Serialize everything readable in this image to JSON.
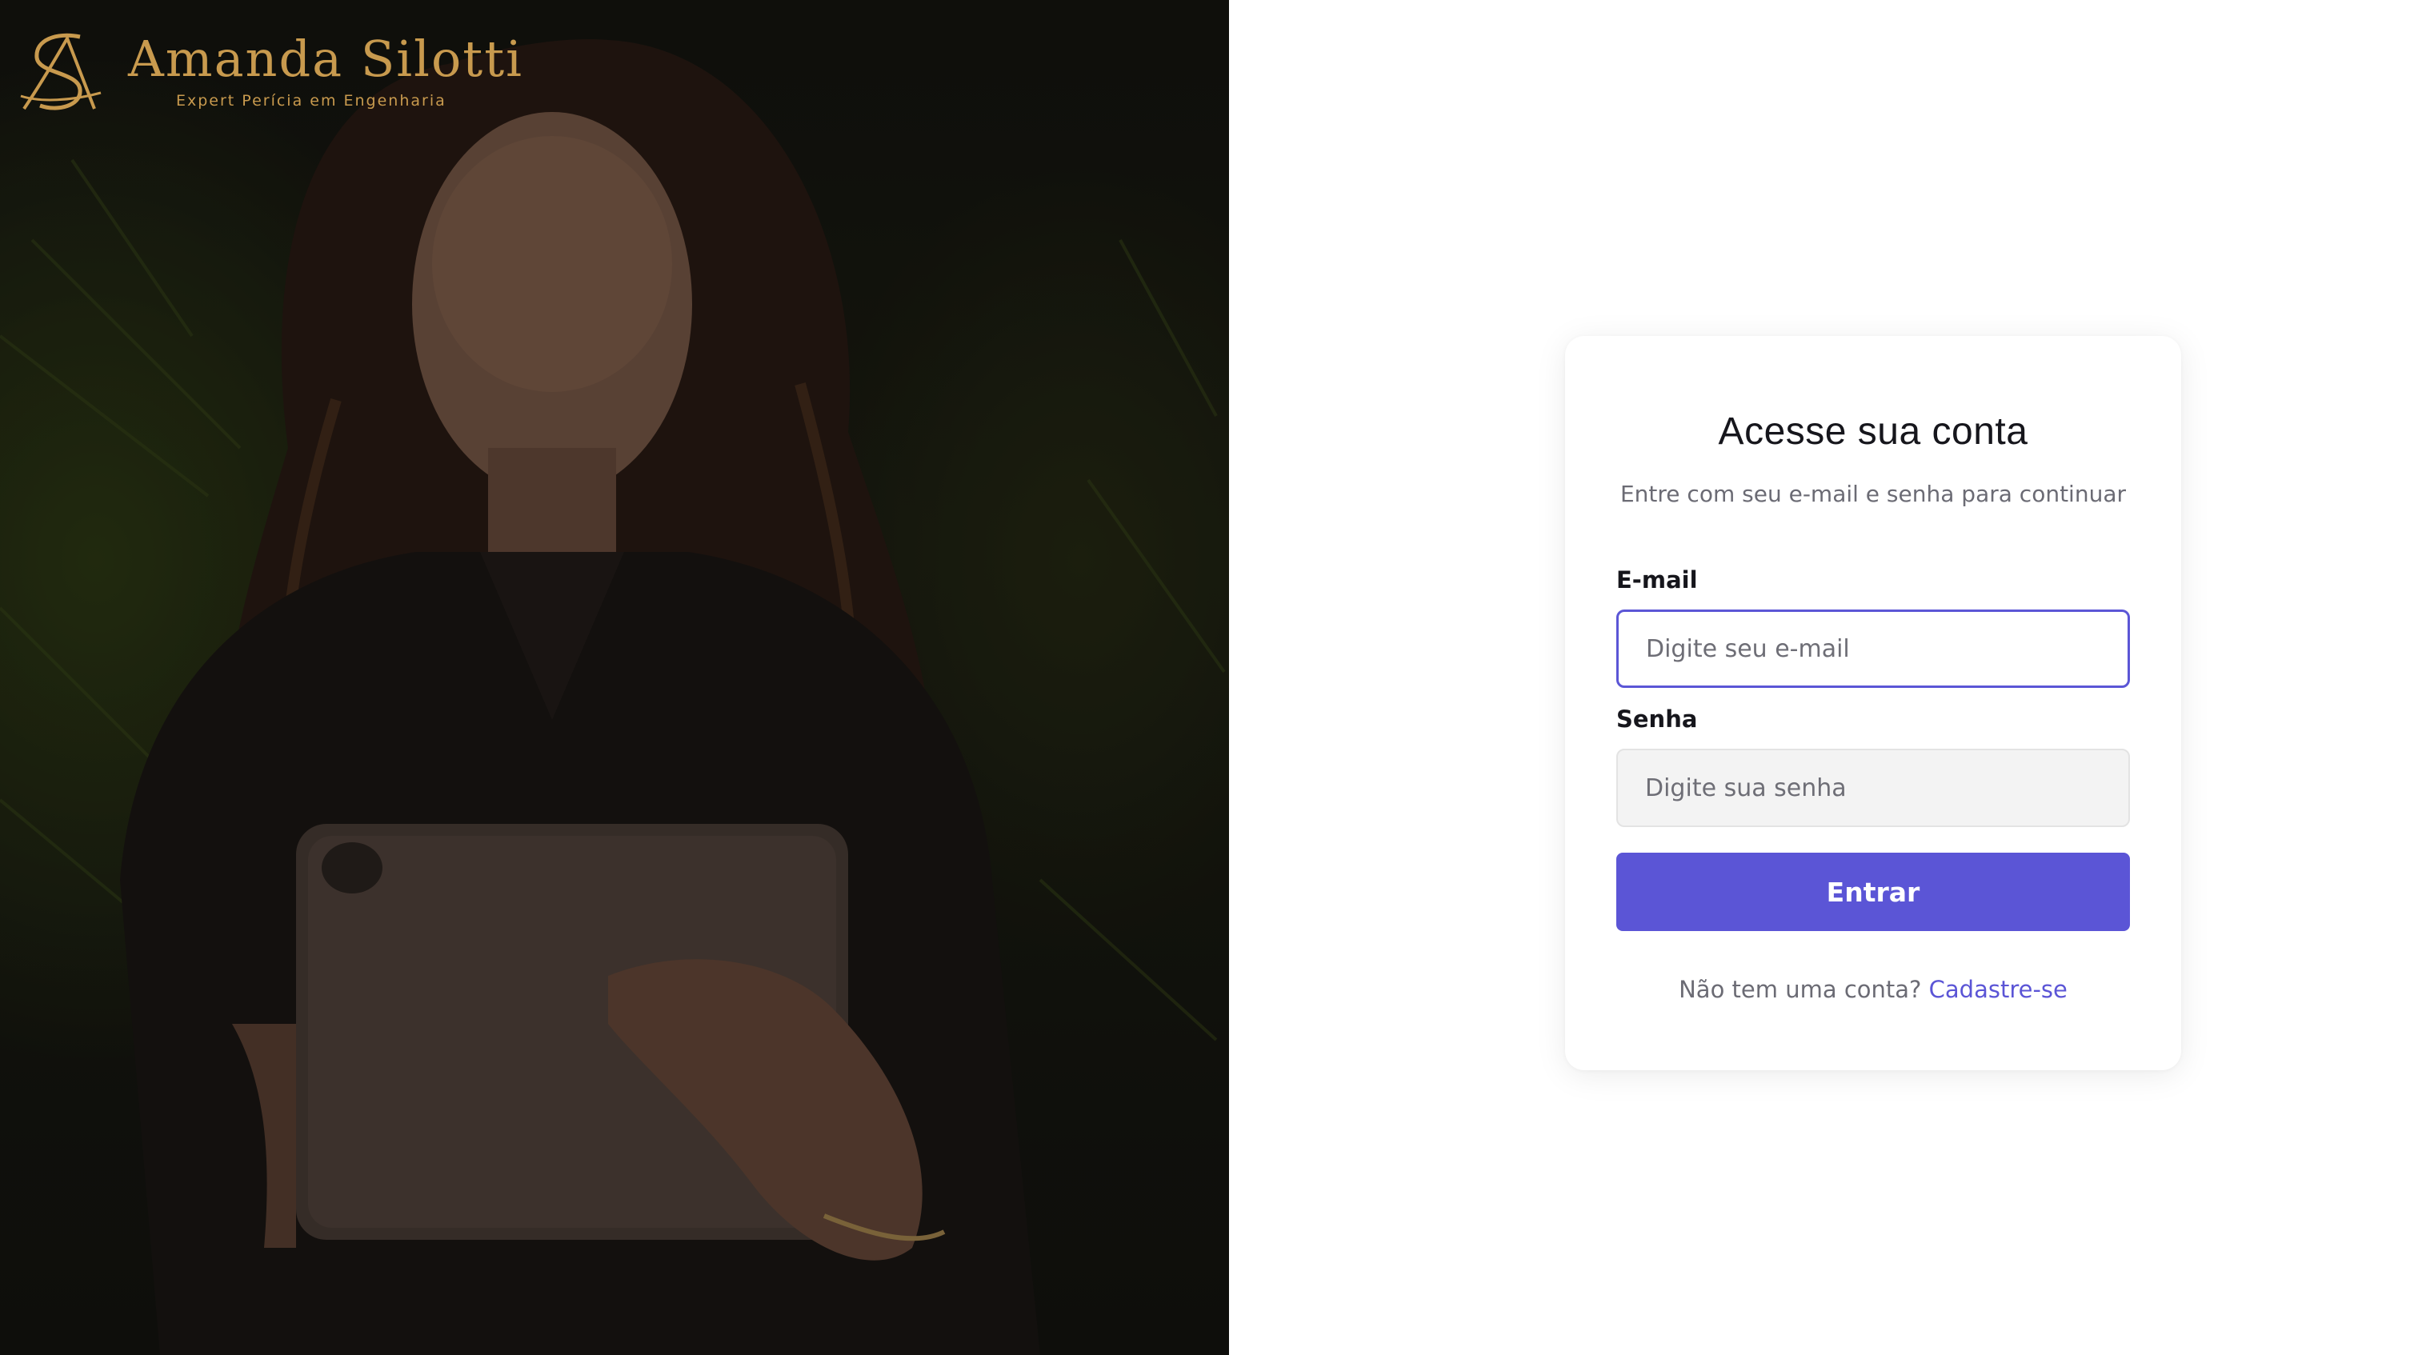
{
  "brand": {
    "name": "Amanda Silotti",
    "tagline": "Expert Perícia em Engenharia",
    "monogram": "AS",
    "logo_icon": "monogram-logo-icon",
    "color": "#c89a4e"
  },
  "hero": {
    "photo_subject": "hero-photo"
  },
  "login": {
    "title": "Acesse sua conta",
    "subtitle": "Entre com seu e-mail e senha para continuar",
    "email": {
      "label": "E-mail",
      "placeholder": "Digite seu e-mail",
      "value": ""
    },
    "password": {
      "label": "Senha",
      "placeholder": "Digite sua senha",
      "value": ""
    },
    "submit_label": "Entrar",
    "signup_prompt": "Não tem uma conta?",
    "signup_link": "Cadastre-se"
  },
  "colors": {
    "accent": "#5b55d6",
    "focus_border": "#5b56d6",
    "brand_gold": "#c89a4e"
  }
}
